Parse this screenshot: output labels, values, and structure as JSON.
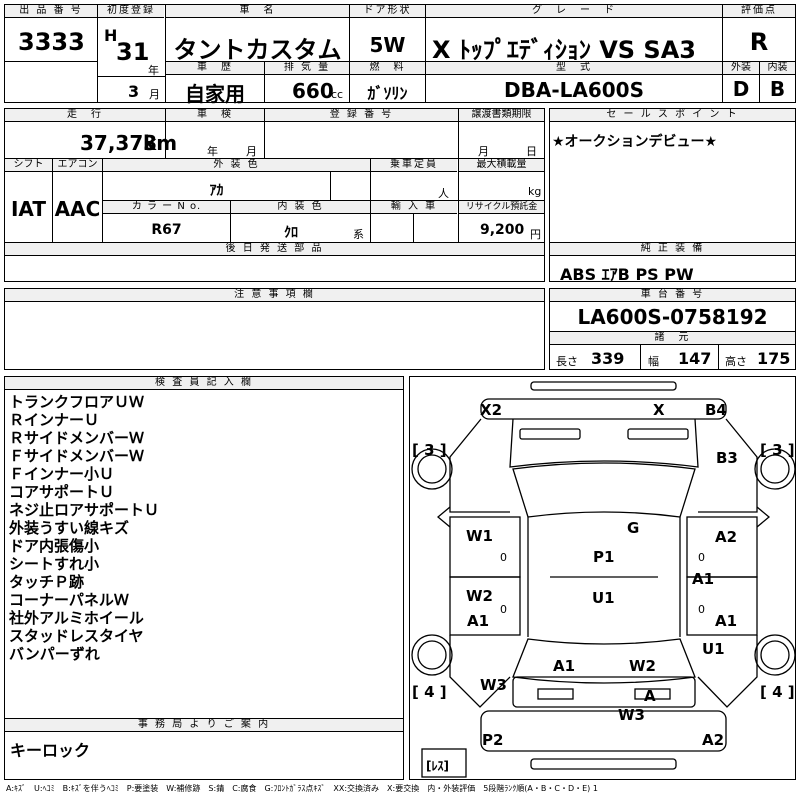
{
  "header": {
    "lot_label": "出 品 番 号",
    "lot": "3333",
    "first_reg_label": "初度登録",
    "era": "H",
    "year": "31",
    "year_unit": "年",
    "month": "3",
    "month_unit": "月",
    "name_label": "車　名",
    "name": "タントカスタム",
    "door_label": "ドア形状",
    "door": "5W",
    "grade_label": "グ　レ　ー　ド",
    "grade": "X ﾄｯﾌﾟｴﾃﾞｨｼｮﾝ VS SA3",
    "score_label": "評価点",
    "score": "R",
    "history_label": "車　歴",
    "history": "自家用",
    "cc_label": "排 気 量",
    "cc": "660",
    "cc_unit": "cc",
    "fuel_label": "燃　料",
    "fuel": "ｶﾞｿﾘﾝ",
    "model_label": "型　式",
    "model": "DBA-LA600S",
    "ext_label": "外装",
    "ext": "D",
    "int_label": "内装",
    "int": "B"
  },
  "row2": {
    "mileage_label": "走　行",
    "mileage": "37,373",
    "mileage_unit": "km",
    "inspection_label": "車　検",
    "year_unit": "年",
    "month_unit": "月",
    "reg_label": "登 録 番 号",
    "transfer_label": "譲渡書類期限",
    "transfer_month": "月",
    "transfer_day": "日",
    "shift_label": "シフト",
    "shift": "IAT",
    "ac_label": "エアコン",
    "ac": "AAC",
    "color_label": "外 装 色",
    "color": "ｱｶ",
    "capacity_label": "乗車定員",
    "capacity_unit": "人",
    "load_label": "最大積載量",
    "load_unit": "kg",
    "color_no_label": "カ ラ ー N o.",
    "color_no": "R67",
    "int_color_label": "内 装 色",
    "int_color": "ｸﾛ",
    "int_color_unit": "系",
    "import_label": "輸 入 車",
    "recycle_label": "リサイクル預託金",
    "recycle": "9,200",
    "recycle_unit": "円",
    "later_label": "後 日 発 送 部 品"
  },
  "sales": {
    "label": "セ ー ル ス ポ イ ン ト",
    "text": "★オークションデビュー★"
  },
  "equip": {
    "label": "純 正 装 備",
    "text": "ABS ｴｱB PS PW"
  },
  "notes": {
    "label": "注 意 事 項 欄"
  },
  "chassis": {
    "label": "車 台 番 号",
    "number": "LA600S-0758192",
    "dim_label": "諸　元",
    "len_label": "長さ",
    "len": "339",
    "wid_label": "幅",
    "wid": "147",
    "hgt_label": "高さ",
    "hgt": "175"
  },
  "inspector": {
    "label": "検 査 員 記 入 欄",
    "lines": [
      "トランクフロアＵＷ",
      "ＲインナーＵ",
      "ＲサイドメンバーＷ",
      "ＦサイドメンバーＷ",
      "Ｆインナー小Ｕ",
      "コアサポートＵ",
      "ネジ止ロアサポートＵ",
      "外装うすい線キズ",
      "ドア内張傷小",
      "シートすれ小",
      "タッチＰ跡",
      "コーナーパネルＷ",
      "社外アルミホイール",
      "スタッドレスタイヤ",
      "バンパーずれ"
    ]
  },
  "office": {
    "label": "事 務 局 よ り ご 案 内",
    "text": "キーロック"
  },
  "damage": {
    "x2": "X2",
    "x": "X",
    "b4": "B4",
    "b3": "B3",
    "g": "G",
    "w1": "W1",
    "p1": "P1",
    "a2_r": "A2",
    "a1_r1": "A1",
    "w2": "W2",
    "a1_l1": "A1",
    "u1_c": "U1",
    "a1_r2": "A1",
    "u1_r": "U1",
    "a1_l2": "A1",
    "w2_b": "W2",
    "w3_l": "W3",
    "a_b": "A",
    "w3_b": "W3",
    "p2": "P2",
    "a2_b": "A2",
    "tire_fl": "[ 3 ]",
    "tire_fr": "[ 3 ]",
    "tire_rl": "[ 4 ]",
    "tire_rr": "[ 4 ]",
    "spare": "[ﾚｽ]",
    "small_l1": "0",
    "small_r1": "0",
    "small_l2": "0",
    "small_r2": "0"
  },
  "legend": "A:ｷｽﾞ　U:ﾍｺﾐ　B:ｷｽﾞを伴うﾍｺﾐ　P:要塗装　W:補修跡　S:錆　C:腐食　G:ﾌﾛﾝﾄｶﾞﾗｽ点ｷｽﾞ　XX:交換済み　X:要交換　内・外装評価　5段階ﾗﾝｸ順(A・B・C・D・E) 1"
}
